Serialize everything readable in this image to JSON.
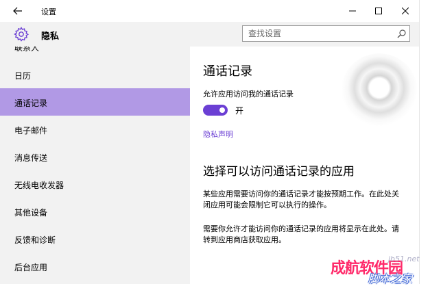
{
  "window": {
    "title": "设置"
  },
  "header": {
    "title": "隐私"
  },
  "search": {
    "placeholder": "查找设置"
  },
  "sidebar": {
    "items": [
      {
        "label": "联系人"
      },
      {
        "label": "日历"
      },
      {
        "label": "通话记录",
        "active": true
      },
      {
        "label": "电子邮件"
      },
      {
        "label": "消息传送"
      },
      {
        "label": "无线电收发器"
      },
      {
        "label": "其他设备"
      },
      {
        "label": "反馈和诊断"
      },
      {
        "label": "后台应用"
      }
    ]
  },
  "content": {
    "title": "通话记录",
    "allow_label": "允许应用访问我的通话记录",
    "toggle_state": "开",
    "toggle_on": true,
    "privacy_link": "隐私声明",
    "subtitle": "选择可以访问通话记录的应用",
    "para1": "某些应用需要访问你的通话记录才能按预期工作。在此处关闭应用可能会限制它可以执行的操作。",
    "para2": "需要你允许才能访问你的通话记录的应用将显示在此处。请转到应用商店获取应用。"
  },
  "watermark": {
    "main": "成航软件园",
    "url": "jb51.net",
    "sub": "脚本之家"
  },
  "colors": {
    "accent": "#6b3fd4",
    "selected": "#b199e5",
    "sidebar_bg": "#f2f2f2"
  }
}
